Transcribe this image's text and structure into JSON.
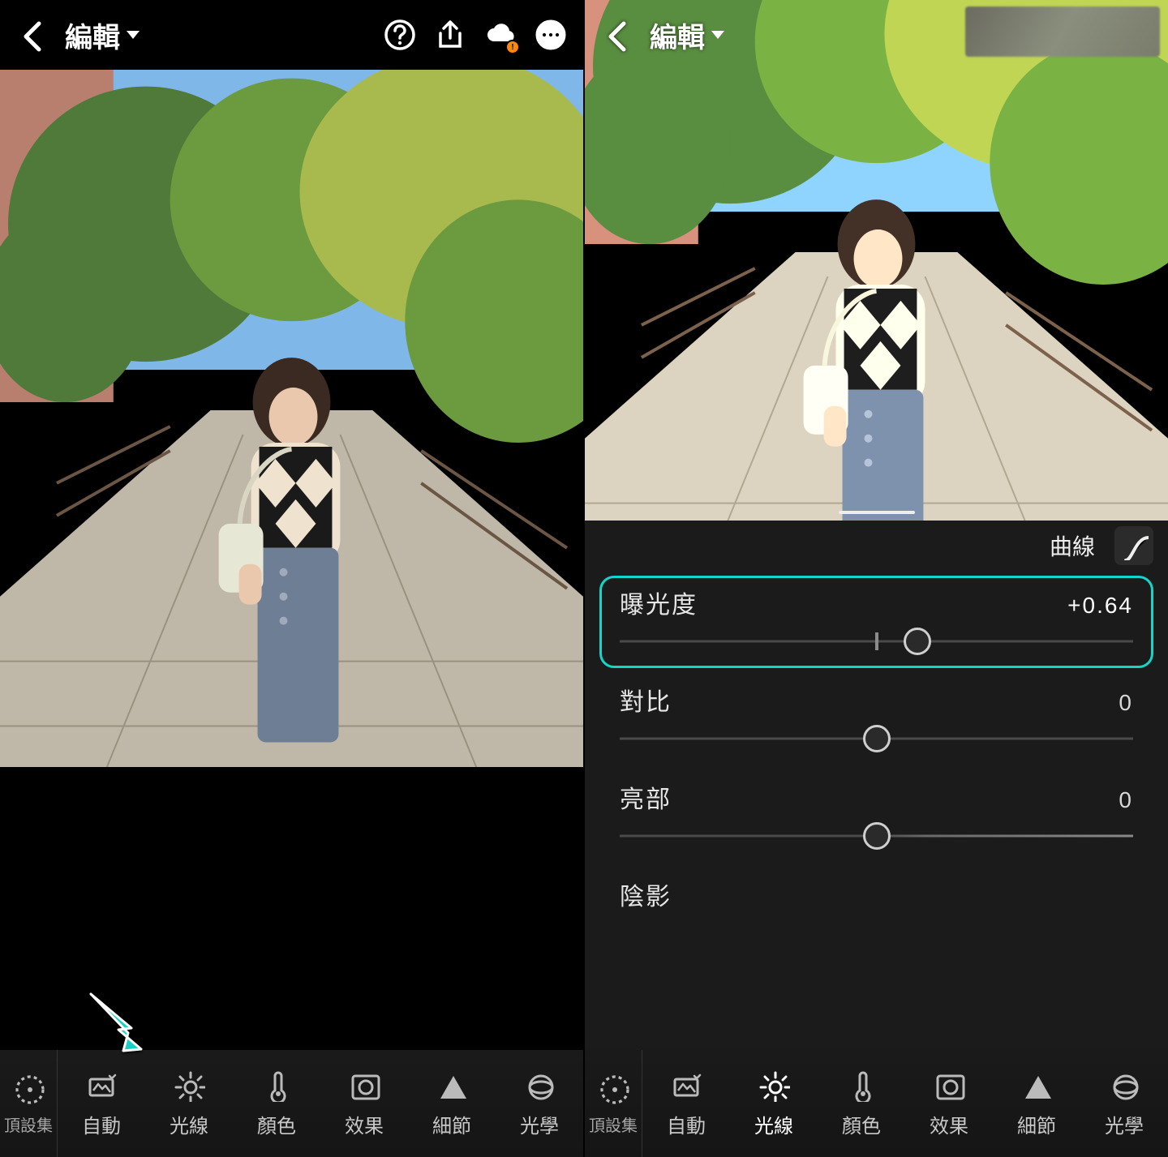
{
  "header": {
    "title": "編輯"
  },
  "arrow_color": "#14d1c4",
  "panel": {
    "curves_label": "曲線",
    "sliders": [
      {
        "key": "exposure",
        "label": "曝光度",
        "value": "+0.64",
        "tick_pct": 50,
        "thumb_pct": 58,
        "highlighted": true,
        "brighter": false
      },
      {
        "key": "contrast",
        "label": "對比",
        "value": "0",
        "tick_pct": 50,
        "thumb_pct": 50,
        "highlighted": false,
        "brighter": false
      },
      {
        "key": "highlights",
        "label": "亮部",
        "value": "0",
        "tick_pct": 50,
        "thumb_pct": 50,
        "highlighted": false,
        "brighter": true
      },
      {
        "key": "shadows",
        "label": "陰影",
        "value": "",
        "tick_pct": null,
        "thumb_pct": null,
        "highlighted": false,
        "brighter": false
      }
    ]
  },
  "tools": {
    "side_label": "頂設集",
    "items": [
      {
        "key": "auto",
        "label": "自動",
        "icon": "auto-icon"
      },
      {
        "key": "light",
        "label": "光線",
        "icon": "sun-icon"
      },
      {
        "key": "color",
        "label": "顏色",
        "icon": "thermometer-icon"
      },
      {
        "key": "effects",
        "label": "效果",
        "icon": "vignette-icon"
      },
      {
        "key": "detail",
        "label": "細節",
        "icon": "triangle-icon"
      },
      {
        "key": "optics",
        "label": "光學",
        "icon": "lens-icon"
      }
    ],
    "active_right": "light"
  }
}
